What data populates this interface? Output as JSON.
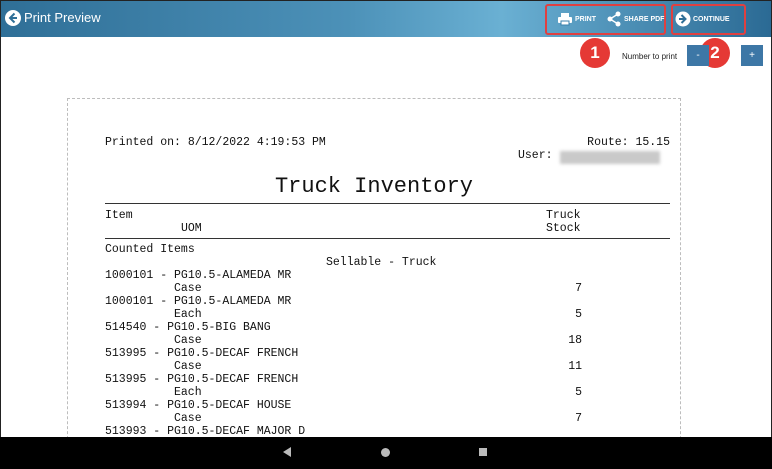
{
  "header": {
    "title": "Print Preview",
    "print_label": "PRINT",
    "share_label": "SHARE PDF",
    "continue_label": "CONTINUE"
  },
  "badges": [
    "1",
    "2"
  ],
  "number_to_print": {
    "label": "Number to print",
    "minus": "-",
    "plus": "+"
  },
  "receipt": {
    "printed_on": "Printed on: 8/12/2022 4:19:53 PM",
    "route": "Route: 15.15",
    "user_label": "User:",
    "title": "Truck Inventory",
    "col_item": "Item",
    "col_uom": "UOM",
    "col_stock_1": "Truck",
    "col_stock_2": "Stock",
    "section": "Counted Items",
    "subsection": "Sellable - Truck",
    "rows": [
      {
        "item": "1000101 - PG10.5-ALAMEDA MR",
        "uom": "Case",
        "qty": "7"
      },
      {
        "item": "1000101 - PG10.5-ALAMEDA MR",
        "uom": "Each",
        "qty": "5"
      },
      {
        "item": "514540 - PG10.5-BIG BANG",
        "uom": "Case",
        "qty": "18"
      },
      {
        "item": "513995 - PG10.5-DECAF FRENCH",
        "uom": "Case",
        "qty": "11"
      },
      {
        "item": "513995 - PG10.5-DECAF FRENCH",
        "uom": "Each",
        "qty": "5"
      },
      {
        "item": "513994 - PG10.5-DECAF HOUSE",
        "uom": "Case",
        "qty": "7"
      },
      {
        "item": "513993 - PG10.5-DECAF MAJOR D",
        "uom": "",
        "qty": ""
      }
    ]
  },
  "colors": {
    "topbar": "#3a82ad",
    "highlight": "#e04040",
    "badge": "#e53935"
  }
}
